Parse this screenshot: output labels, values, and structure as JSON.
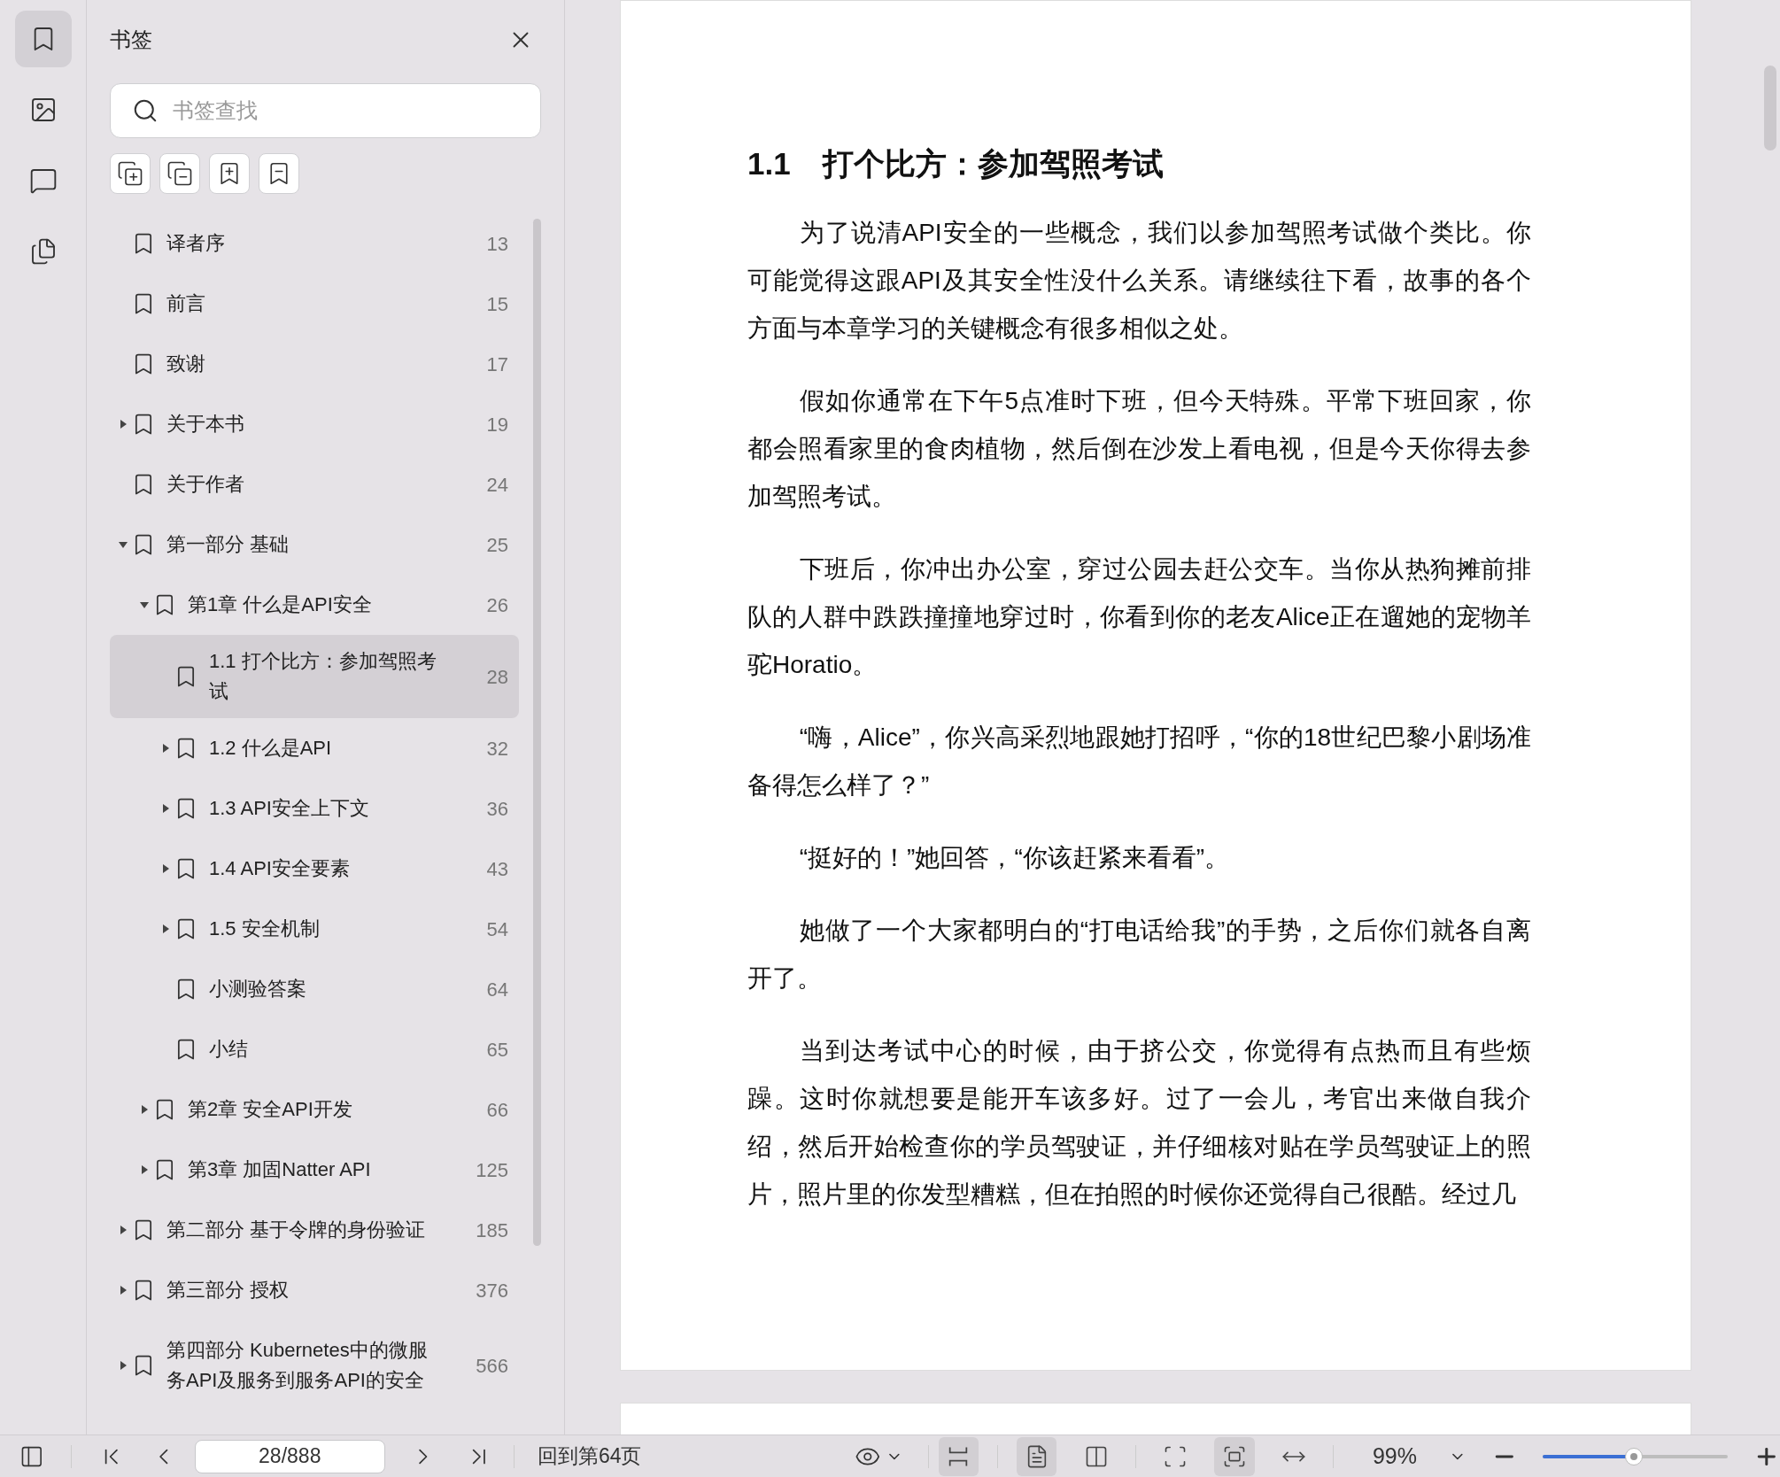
{
  "rail": [
    {
      "selected": true
    },
    {
      "selected": false
    },
    {
      "selected": false
    },
    {
      "selected": false
    }
  ],
  "panel": {
    "title": "书签",
    "search": {
      "placeholder": "书签查找"
    }
  },
  "bookmarks": [
    {
      "title": "译者序",
      "page": "13",
      "selected": false
    },
    {
      "title": "前言",
      "page": "15",
      "selected": false
    },
    {
      "title": "致谢",
      "page": "17",
      "selected": false
    },
    {
      "title": "关于本书",
      "page": "19",
      "expanded": false,
      "selected": false
    },
    {
      "title": "关于作者",
      "page": "24",
      "selected": false
    },
    {
      "title": "第一部分 基础",
      "page": "25",
      "expanded": true,
      "selected": false,
      "children": [
        {
          "title": "第1章 什么是API安全",
          "page": "26",
          "expanded": true,
          "selected": false,
          "children": [
            {
              "title": "1.1 打个比方：参加驾照考试",
              "page": "28",
              "selected": true
            },
            {
              "title": "1.2 什么是API",
              "page": "32",
              "expanded": false,
              "selected": false
            },
            {
              "title": "1.3 API安全上下文",
              "page": "36",
              "expanded": false,
              "selected": false
            },
            {
              "title": "1.4 API安全要素",
              "page": "43",
              "expanded": false,
              "selected": false
            },
            {
              "title": "1.5 安全机制",
              "page": "54",
              "expanded": false,
              "selected": false
            },
            {
              "title": "小测验答案",
              "page": "64",
              "selected": false
            },
            {
              "title": "小结",
              "page": "65",
              "selected": false
            }
          ]
        },
        {
          "title": "第2章 安全API开发",
          "page": "66",
          "expanded": false,
          "selected": false
        },
        {
          "title": "第3章 加固Natter API",
          "page": "125",
          "expanded": false,
          "selected": false
        }
      ]
    },
    {
      "title": "第二部分 基于令牌的身份验证",
      "page": "185",
      "expanded": false,
      "selected": false
    },
    {
      "title": "第三部分 授权",
      "page": "376",
      "expanded": false,
      "selected": false
    },
    {
      "title": "第四部分 Kubernetes中的微服务API及服务到服务API的安全",
      "page": "566",
      "expanded": false,
      "selected": false
    }
  ],
  "document": {
    "heading_number": "1.1",
    "heading": "打个比方：参加驾照考试",
    "paragraphs": [
      "为了说清API安全的一些概念，我们以参加驾照考试做个类比。你可能觉得这跟API及其安全性没什么关系。请继续往下看，故事的各个方面与本章学习的关键概念有很多相似之处。",
      "假如你通常在下午5点准时下班，但今天特殊。平常下班回家，你都会照看家里的食肉植物，然后倒在沙发上看电视，但是今天你得去参加驾照考试。",
      "下班后，你冲出办公室，穿过公园去赶公交车。当你从热狗摊前排队的人群中跌跌撞撞地穿过时，你看到你的老友Alice正在遛她的宠物羊驼Horatio。",
      "“嗨，Alice”，你兴高采烈地跟她打招呼，“你的18世纪巴黎小剧场准备得怎么样了？”",
      "“挺好的！”她回答，“你该赶紧来看看”。",
      "她做了一个大家都明白的“打电话给我”的手势，之后你们就各自离开了。",
      "当到达考试中心的时候，由于挤公交，你觉得有点热而且有些烦躁。这时你就想要是能开车该多好。过了一会儿，考官出来做自我介绍，然后开始检查你的学员驾驶证，并仔细核对贴在学员驾驶证上的照片，照片里的你发型糟糕，但在拍照的时候你还觉得自己很酷。经过几"
    ]
  },
  "toolbar": {
    "page_field": "28/888",
    "goto_link": "回到第64页",
    "view_modes": [
      {
        "selected": true
      },
      {
        "selected": true
      },
      {
        "selected": false
      },
      {
        "selected": false
      },
      {
        "selected": true
      },
      {
        "selected": false
      }
    ],
    "zoom": "99%",
    "zoom_slider": {
      "level": 0.49
    }
  }
}
